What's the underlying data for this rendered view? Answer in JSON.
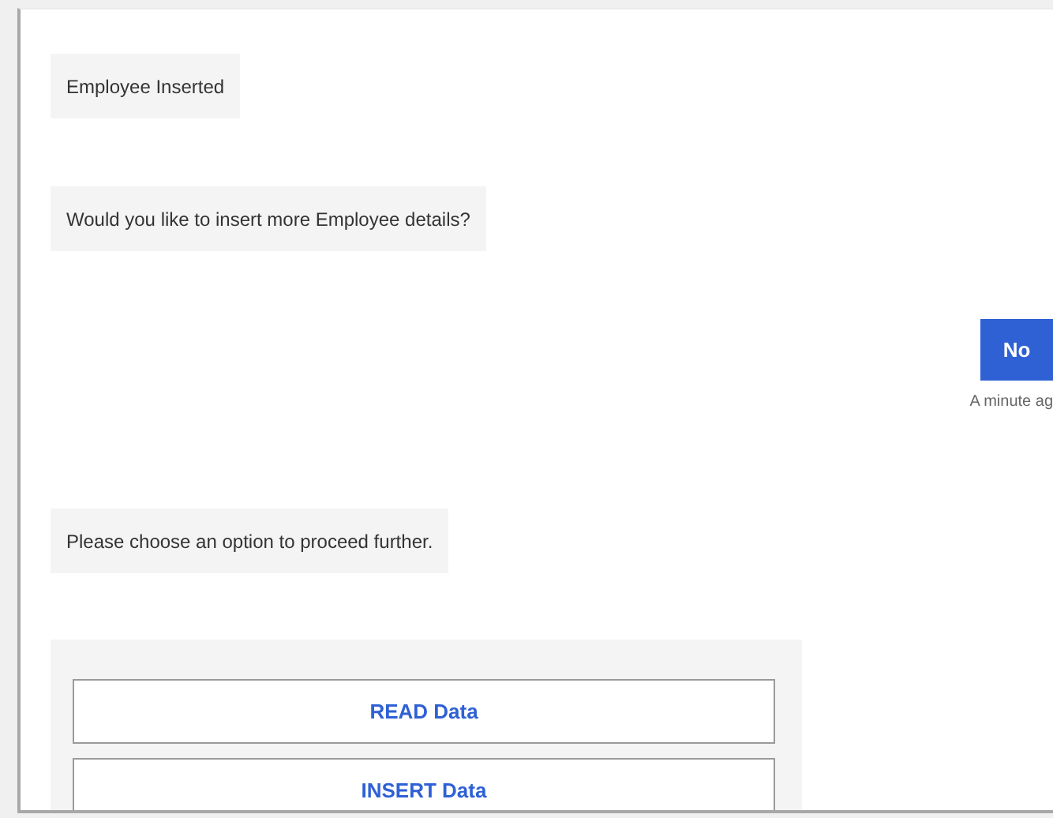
{
  "messages": [
    {
      "kind": "bot",
      "text": "Employee Inserted"
    },
    {
      "kind": "bot",
      "text": "Would you like to insert more Employee details?"
    },
    {
      "kind": "user",
      "text": "No",
      "time": "A minute ag"
    },
    {
      "kind": "bot",
      "text": "Please choose an option to proceed further."
    },
    {
      "kind": "options",
      "options": [
        "READ Data",
        "INSERT Data"
      ]
    }
  ]
}
